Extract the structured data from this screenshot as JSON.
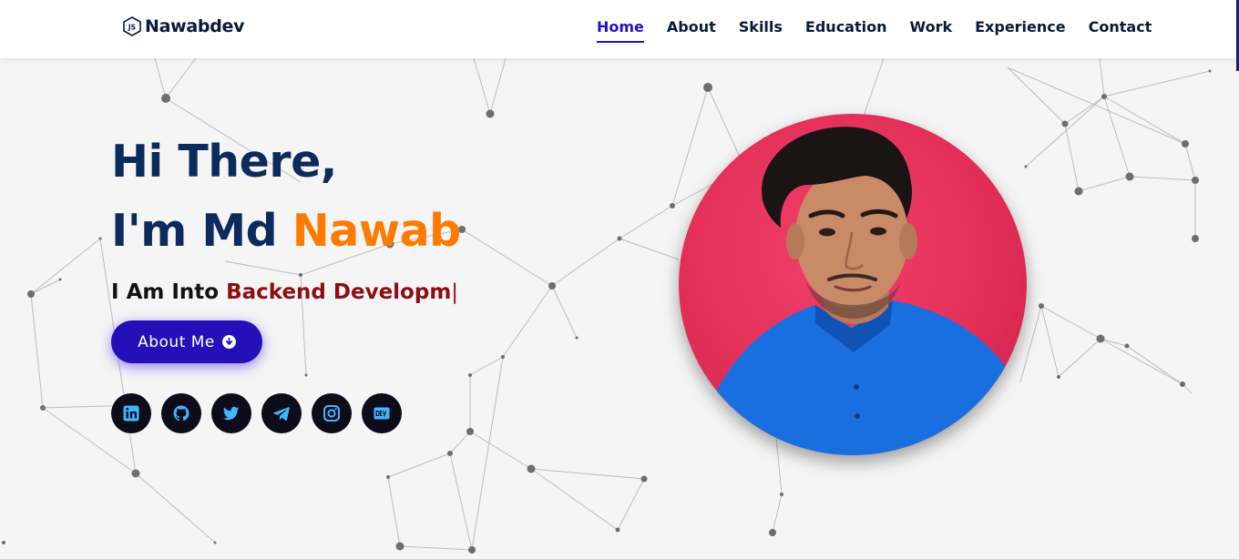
{
  "brand": {
    "name": "Nawabdev",
    "icon": "js-hex-icon"
  },
  "nav": {
    "items": [
      {
        "label": "Home",
        "active": true
      },
      {
        "label": "About",
        "active": false
      },
      {
        "label": "Skills",
        "active": false
      },
      {
        "label": "Education",
        "active": false
      },
      {
        "label": "Work",
        "active": false
      },
      {
        "label": "Experience",
        "active": false
      },
      {
        "label": "Contact",
        "active": false
      }
    ]
  },
  "hero": {
    "greeting": "Hi There,",
    "intro_prefix": "I'm Md ",
    "intro_name": "Nawab",
    "subtitle_prefix": "I Am Into ",
    "subtitle_typed": "Backend Developm",
    "subtitle_cursor": "|",
    "button_label": "About Me",
    "button_icon": "arrow-down-circle-icon"
  },
  "socials": [
    {
      "icon": "linkedin-icon"
    },
    {
      "icon": "github-icon"
    },
    {
      "icon": "twitter-icon"
    },
    {
      "icon": "telegram-icon"
    },
    {
      "icon": "instagram-icon"
    },
    {
      "icon": "dev-icon"
    }
  ],
  "colors": {
    "navy": "#0d2a5c",
    "accent_orange": "#ff7a00",
    "typed_red": "#8b0f12",
    "primary": "#2410b8",
    "photo_bg": "#e22f58",
    "social_icon": "#3fb7ff"
  }
}
